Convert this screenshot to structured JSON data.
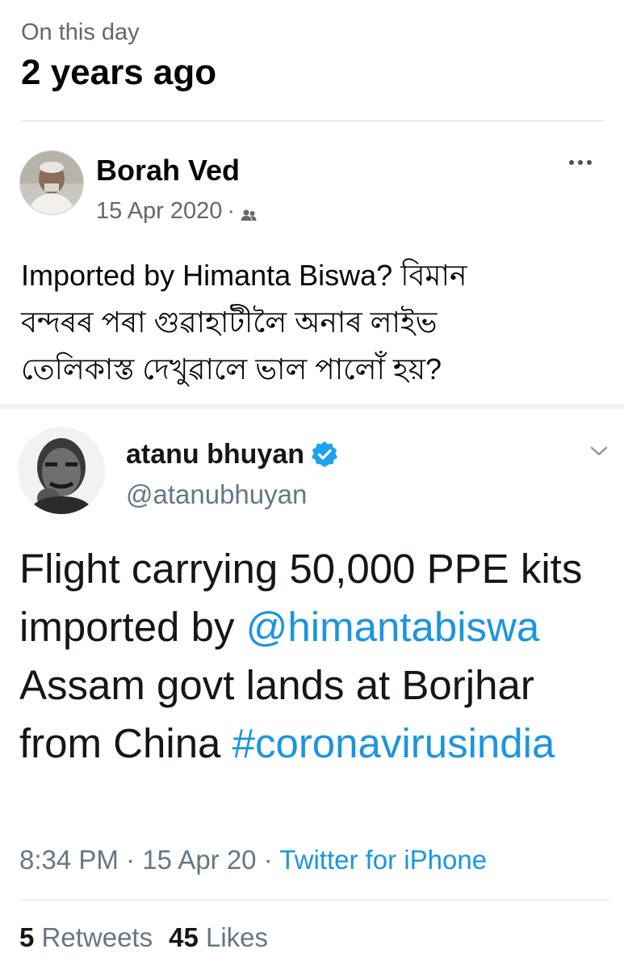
{
  "memory": {
    "label": "On this day",
    "title": "2 years ago"
  },
  "post": {
    "author": "Borah Ved",
    "date": "15 Apr 2020",
    "meta_separator": "·",
    "audience_icon": "friends-icon",
    "more_icon": "more-options-icon",
    "text_line1": "Imported by Himanta Biswa? বিমান",
    "text_line2": "বন্দৰৰ পৰা গুৱাহাটীলৈ অনাৰ লাইভ",
    "text_line3": "তেলিকাস্ত দেখুৱালে ভাল পালোঁ হয়?"
  },
  "tweet": {
    "name": "atanu bhuyan",
    "verified_icon": "verified-icon",
    "handle": "@atanubhuyan",
    "menu_icon": "chevron-down-icon",
    "text_part1": "Flight carrying 50,000 PPE kits imported by ",
    "mention": "@himantabiswa",
    "text_part2": " Assam govt lands at Borjhar from China ",
    "hashtag": "#coronavirusindia",
    "time": "8:34 PM",
    "sep": "·",
    "date": "15 Apr 20",
    "source": "Twitter for iPhone",
    "retweets_count": "5",
    "retweets_label": "Retweets",
    "likes_count": "45",
    "likes_label": "Likes"
  },
  "colors": {
    "link": "#1b95e0",
    "verified": "#1da1f2",
    "secondary_text": "#65676b"
  }
}
